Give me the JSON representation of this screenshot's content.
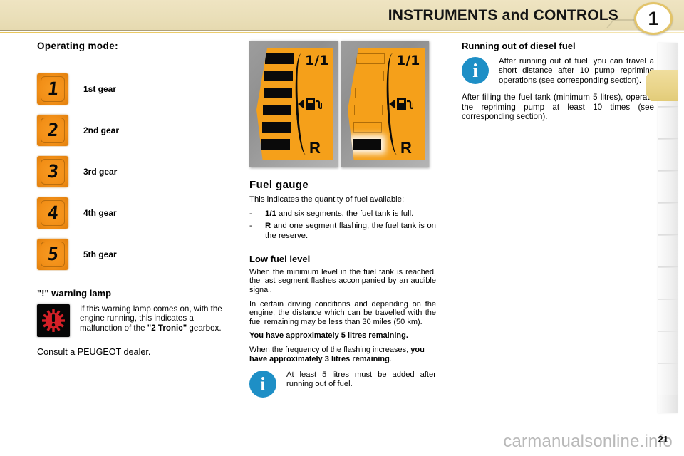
{
  "header": {
    "title": "INSTRUMENTS and CONTROLS",
    "chapter": "1"
  },
  "left_column": {
    "section_title": "Operating mode:",
    "gears": [
      {
        "digit": "1",
        "label": "1st gear"
      },
      {
        "digit": "2",
        "label": "2nd gear"
      },
      {
        "digit": "3",
        "label": "3rd gear"
      },
      {
        "digit": "4",
        "label": "4th gear"
      },
      {
        "digit": "5",
        "label": "5th gear"
      }
    ],
    "warning": {
      "title": "\"!\" warning lamp",
      "icon_name": "gear-exclamation-warning-lamp",
      "text_1": "If this warning lamp comes on, with the engine running, this indicates a malfunction of the ",
      "text_bold": "\"2 Tronic\"",
      "text_2": " gearbox.",
      "consult": "Consult a PEUGEOT dealer."
    }
  },
  "middle_column": {
    "gauge_full": {
      "caption_top": "1/1",
      "caption_bottom": "R",
      "segments_filled": 6,
      "segments_total": 6,
      "state": "full"
    },
    "gauge_reserve": {
      "caption_top": "1/1",
      "caption_bottom": "R",
      "segments_filled": 1,
      "segments_total": 6,
      "state": "reserve-flashing"
    },
    "fuel_gauge": {
      "title": "Fuel gauge",
      "intro": "This indicates the quantity of fuel available:",
      "bullets": [
        {
          "marker": "-",
          "bold": "1/1",
          "rest": " and six segments, the fuel tank is full."
        },
        {
          "marker": "-",
          "bold": "R",
          "rest": " and one segment flashing, the fuel tank is on the reserve."
        }
      ]
    },
    "low_fuel": {
      "title": "Low fuel level",
      "para_1": "When the minimum level in the fuel tank is reached, the last segment flashes accompanied by an audible signal.",
      "para_2": "In certain driving conditions and depending on the engine, the distance which can be travelled with the fuel remaining may be less than 30 miles (50 km).",
      "bold_line": "You have approximately 5 litres remaining.",
      "para_3_lead": "When the frequency of the flashing increases, ",
      "para_3_bold": "you have approximately 3 litres remaining",
      "para_3_tail": ".",
      "info_note": "At least 5 litres must be added after running out of fuel."
    }
  },
  "right_column": {
    "diesel": {
      "title": "Running out of diesel fuel",
      "info_note": "After running out of fuel, you can travel a short distance after 10 pump repriming operations (see corresponding section).",
      "para": "After filling the fuel tank (minimum 5 litres), operate the repriming pump at least 10 times (see corresponding section)."
    }
  },
  "footer": {
    "page_number": "21",
    "watermark": "carmanualsonline.info"
  },
  "colors": {
    "header_beige": "#eadfb9",
    "gold_rule": "#e8c558",
    "gauge_orange": "#f5a01a",
    "gear_orange": "#f28f17",
    "info_blue": "#1e8fc6",
    "warning_red": "#d42027",
    "tab_active": "#e9d489"
  }
}
